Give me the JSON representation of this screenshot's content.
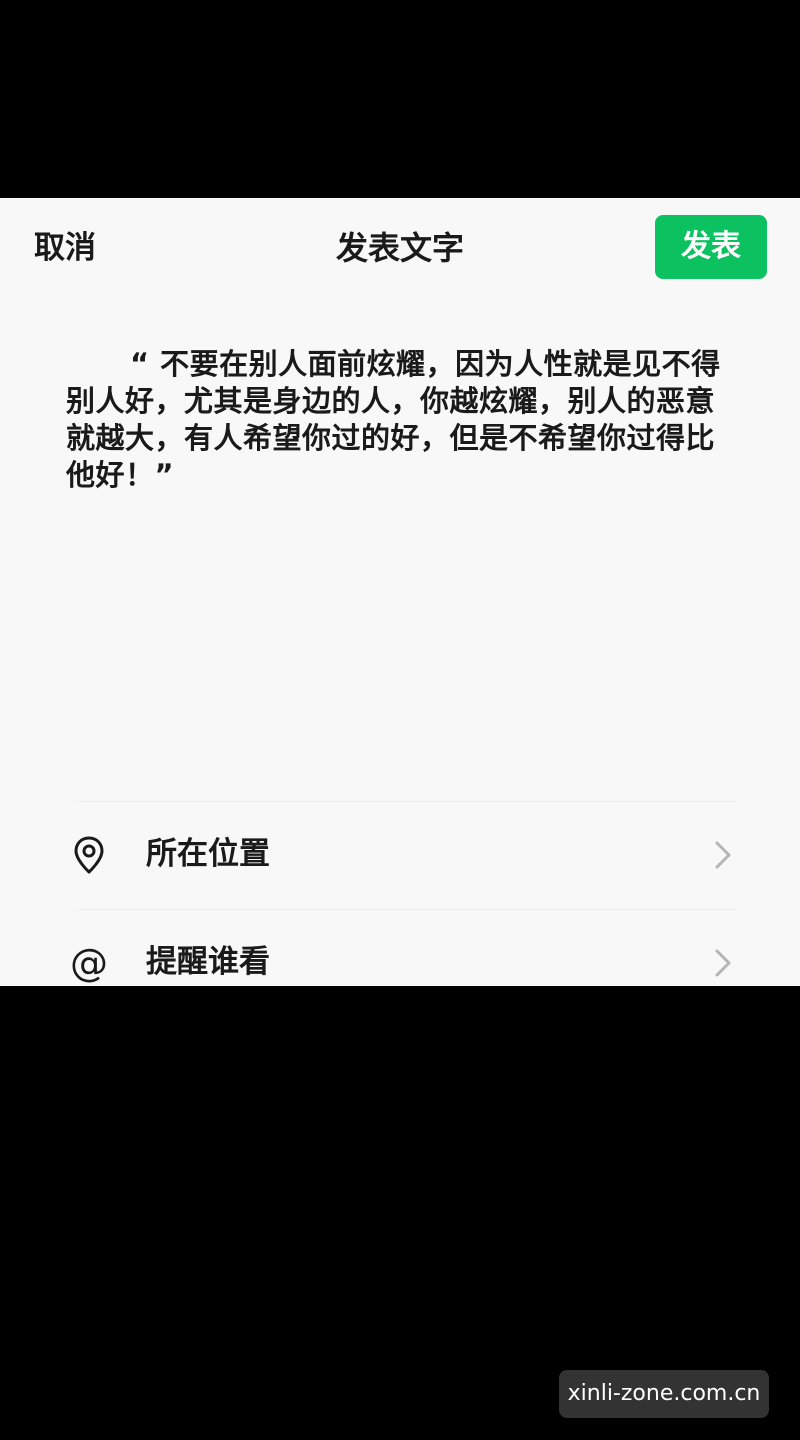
{
  "header": {
    "cancel_label": "取消",
    "title": "发表文字",
    "publish_label": "发表"
  },
  "post": {
    "text": "“ 不要在别人面前炫耀，因为人性就是见不得别人好，尤其是身边的人，你越炫耀，别人的恶意就越大，有人希望你过的好，但是不希望你过得比他好！”"
  },
  "options": {
    "location": {
      "label": "所在位置",
      "icon": "location-pin-icon"
    },
    "mention": {
      "label": "提醒谁看",
      "icon": "at-icon",
      "glyph": "@"
    }
  },
  "watermark": {
    "text": "xinli-zone.com.cn"
  },
  "colors": {
    "accent": "#0bc160",
    "panel_bg": "#f8f8f8",
    "text": "#1a1a1a",
    "chevron": "#b5b5b5",
    "outer_bg": "#000000"
  }
}
